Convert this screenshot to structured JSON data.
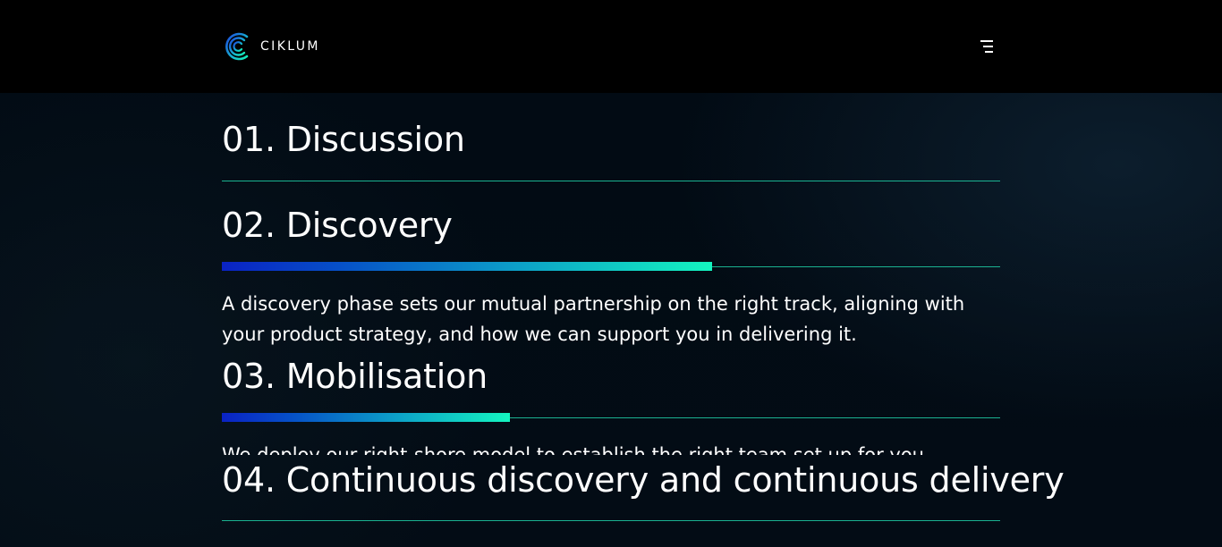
{
  "header": {
    "brand_name": "CIKLUM",
    "logo_icon": "ciklum-logo-icon",
    "menu_icon": "hamburger-menu-icon",
    "accent_colors": [
      "#0a22c4",
      "#14f5c0",
      "#1fcfa6"
    ]
  },
  "steps": [
    {
      "title": "01. Discussion",
      "description": "",
      "progress": 0
    },
    {
      "title": "02. Discovery",
      "description": "A discovery phase sets our mutual partnership on the right track, aligning with your product strategy, and how we can support you in delivering it.",
      "progress": 0.63
    },
    {
      "title": "03. Mobilisation",
      "description": "We deploy our right-shore model to establish the right team set up for you, utilising",
      "progress": 0.37
    },
    {
      "title": "04. Continuous discovery and continuous delivery",
      "description": "",
      "progress": 0
    }
  ]
}
